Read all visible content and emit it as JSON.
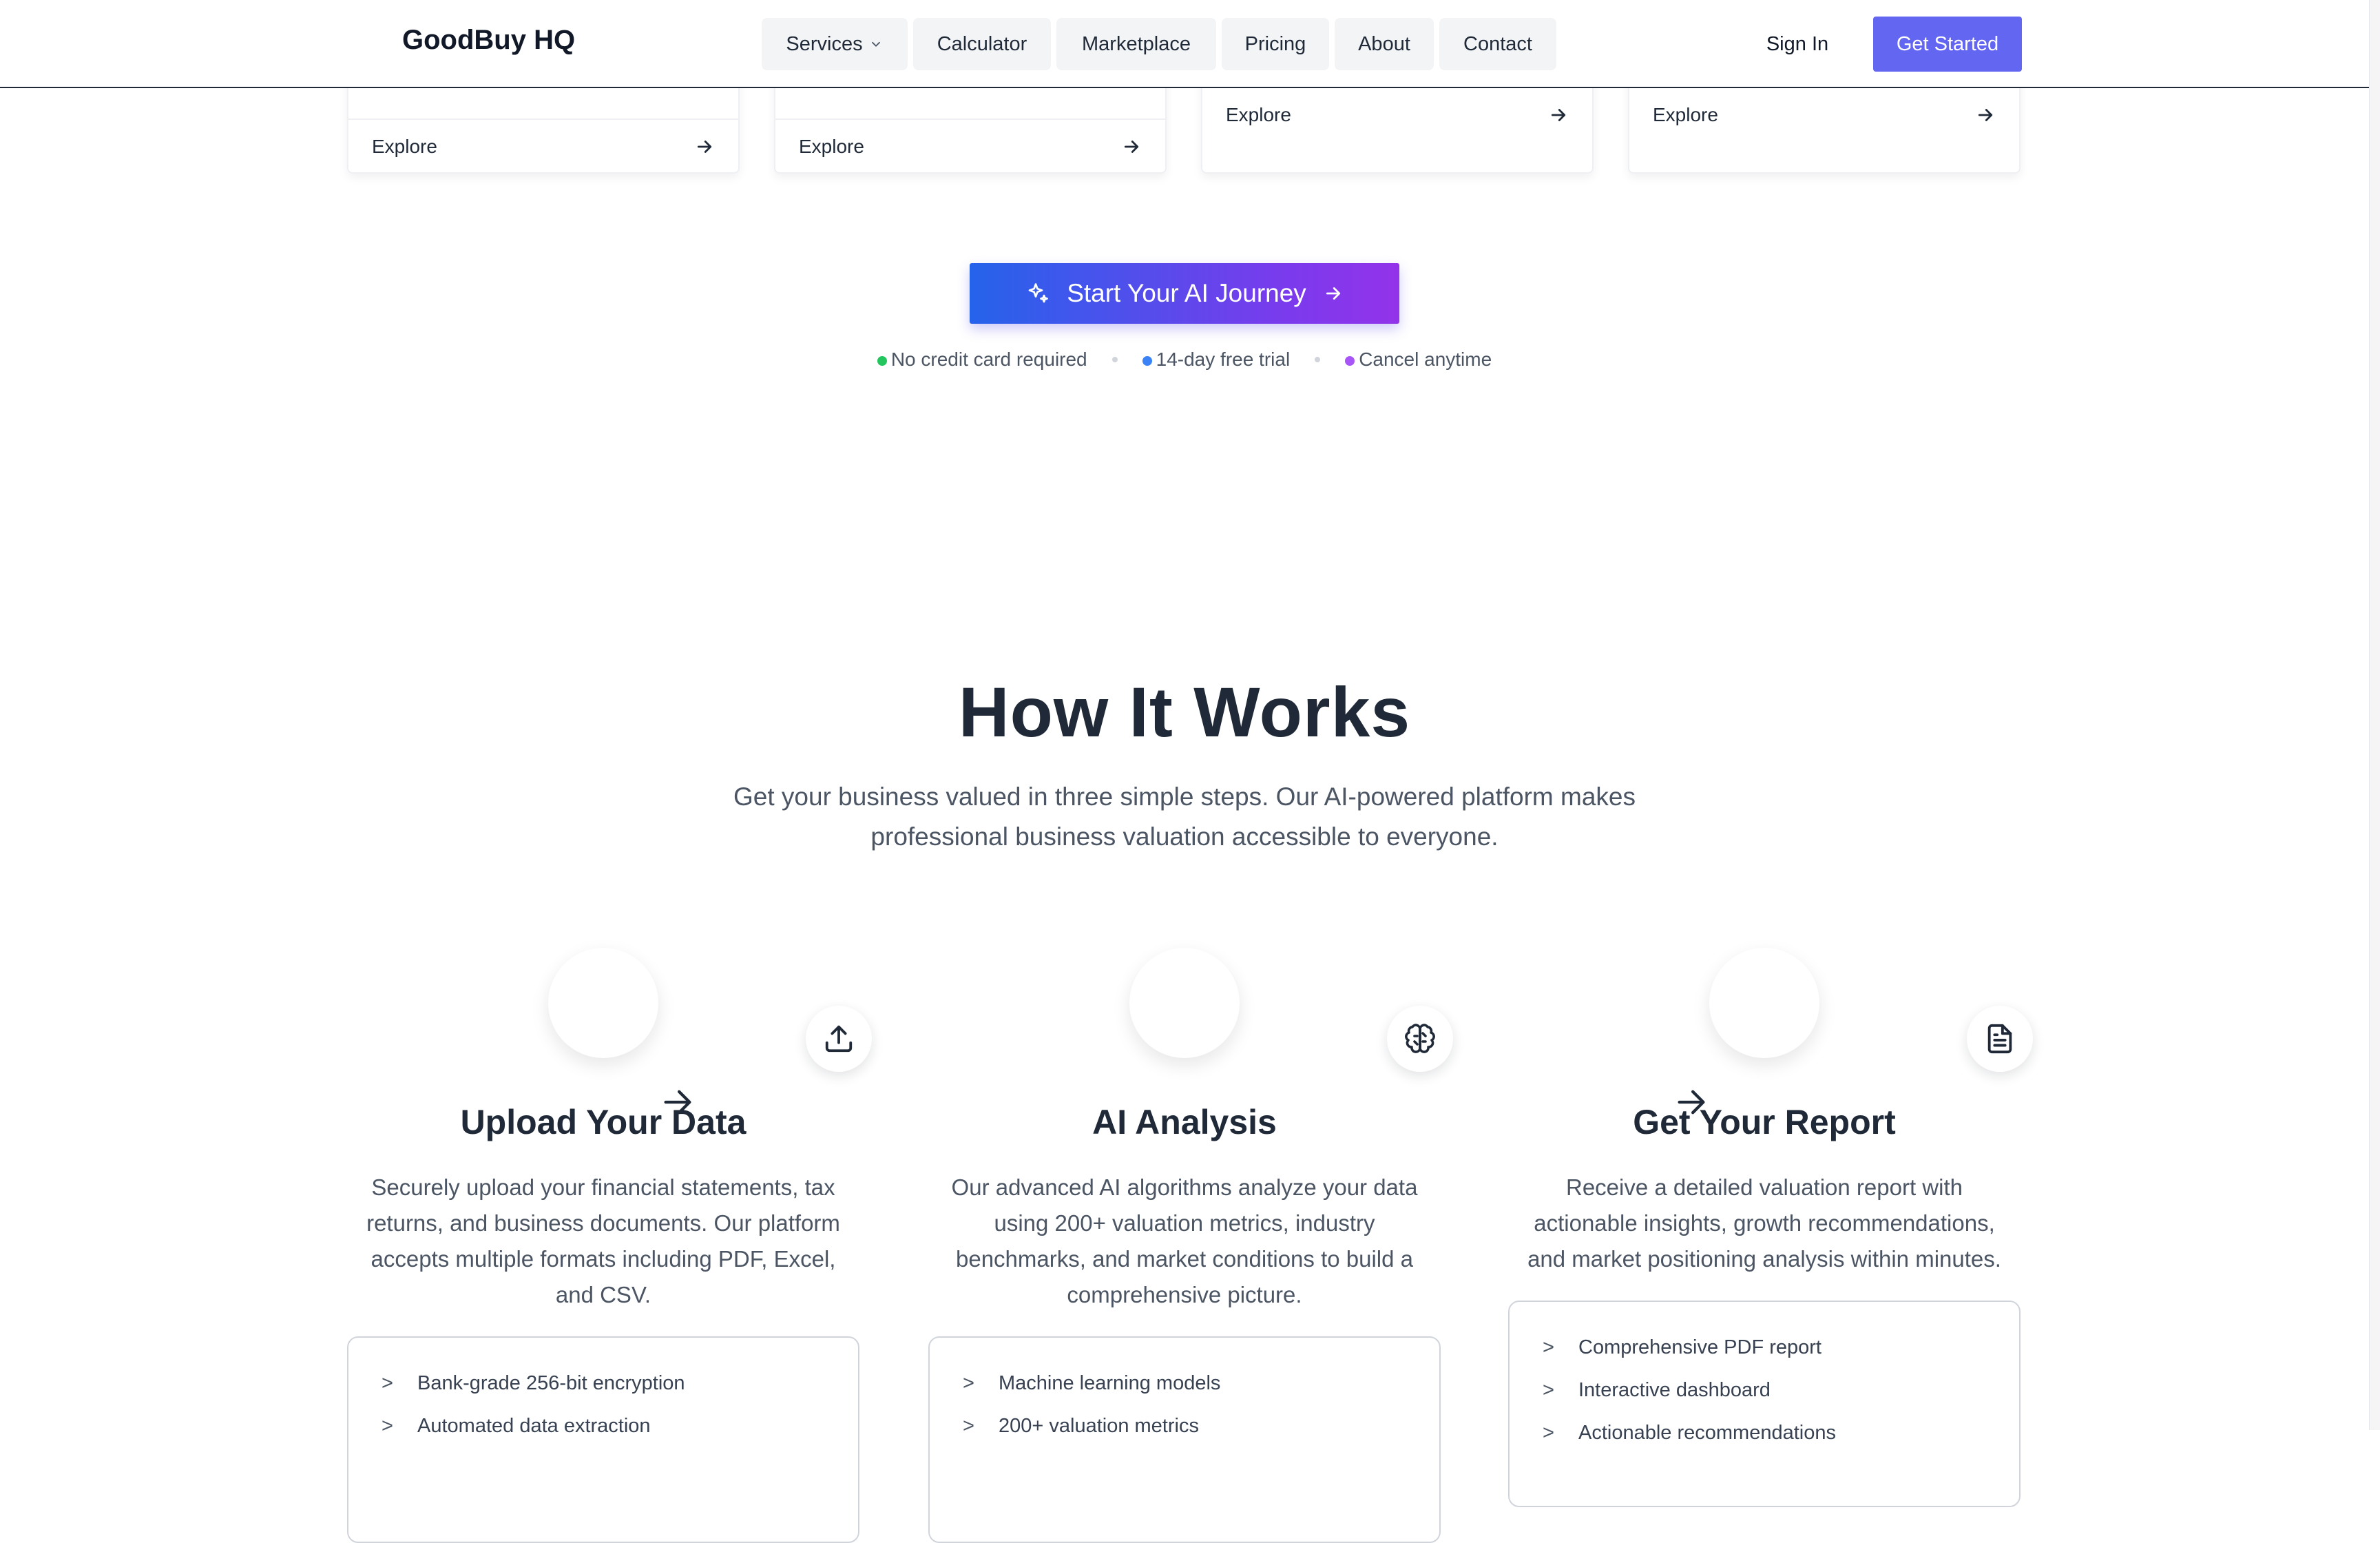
{
  "nav": {
    "logo": "GoodBuy HQ",
    "items": [
      {
        "label": "Services",
        "has_dropdown": true
      },
      {
        "label": "Calculator"
      },
      {
        "label": "Marketplace"
      },
      {
        "label": "Pricing"
      },
      {
        "label": "About"
      },
      {
        "label": "Contact"
      }
    ],
    "sign_in": "Sign In",
    "get_started": "Get Started"
  },
  "cards": [
    {
      "explore": "Explore"
    },
    {
      "explore": "Explore"
    },
    {
      "explore": "Explore"
    },
    {
      "explore": "Explore"
    }
  ],
  "cta": {
    "label": "Start Your AI Journey",
    "perks": [
      {
        "text": "No credit card required",
        "color": "#22c55e"
      },
      {
        "text": "14-day free trial",
        "color": "#3b82f6"
      },
      {
        "text": "Cancel anytime",
        "color": "#a855f7"
      }
    ]
  },
  "how": {
    "title": "How It Works",
    "lead": "Get your business valued in three simple steps. Our AI-powered platform makes professional business valuation accessible to everyone.",
    "steps": [
      {
        "title": "Upload Your Data",
        "icon": "upload-icon",
        "desc": "Securely upload your financial statements, tax returns, and business documents. Our platform accepts multiple formats including PDF, Excel, and CSV.",
        "features": [
          "Bank-grade 256-bit encryption",
          "Automated data extraction"
        ]
      },
      {
        "title": "AI Analysis",
        "icon": "brain-icon",
        "desc": "Our advanced AI algorithms analyze your data using 200+ valuation metrics, industry benchmarks, and market conditions to build a comprehensive picture.",
        "features": [
          "Machine learning models",
          "200+ valuation metrics"
        ]
      },
      {
        "title": "Get Your Report",
        "icon": "document-icon",
        "desc": "Receive a detailed valuation report with actionable insights, growth recommendations, and market positioning analysis within minutes.",
        "features": [
          "Comprehensive PDF report",
          "Interactive dashboard",
          "Actionable recommendations"
        ]
      }
    ],
    "feature_marker": ">"
  },
  "colors": {
    "brand": "#6366f1",
    "heading": "#1f2937",
    "body": "#4b5563"
  }
}
